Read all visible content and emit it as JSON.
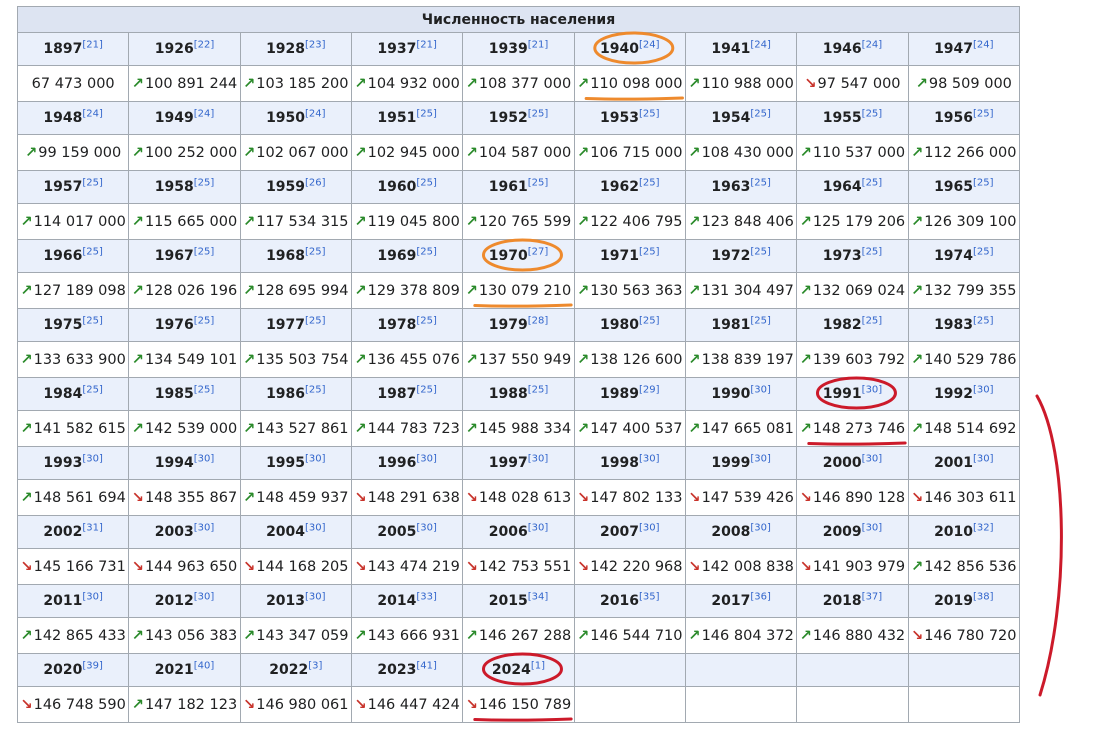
{
  "table": {
    "title": "Численность населения",
    "columns": 9,
    "rows": [
      [
        [
          "1897",
          "[21]",
          ""
        ],
        [
          "1926",
          "[22]",
          "up"
        ],
        [
          "1928",
          "[23]",
          "up"
        ],
        [
          "1937",
          "[21]",
          "up"
        ],
        [
          "1939",
          "[21]",
          "up"
        ],
        [
          "1940",
          "[24]",
          "up"
        ],
        [
          "1941",
          "[24]",
          "up"
        ],
        [
          "1946",
          "[24]",
          "down"
        ],
        [
          "1947",
          "[24]",
          "up"
        ]
      ],
      [
        [
          "1948",
          "[24]",
          "up"
        ],
        [
          "1949",
          "[24]",
          "up"
        ],
        [
          "1950",
          "[24]",
          "up"
        ],
        [
          "1951",
          "[25]",
          "up"
        ],
        [
          "1952",
          "[25]",
          "up"
        ],
        [
          "1953",
          "[25]",
          "up"
        ],
        [
          "1954",
          "[25]",
          "up"
        ],
        [
          "1955",
          "[25]",
          "up"
        ],
        [
          "1956",
          "[25]",
          "up"
        ]
      ],
      [
        [
          "1957",
          "[25]",
          "up"
        ],
        [
          "1958",
          "[25]",
          "up"
        ],
        [
          "1959",
          "[26]",
          "up"
        ],
        [
          "1960",
          "[25]",
          "up"
        ],
        [
          "1961",
          "[25]",
          "up"
        ],
        [
          "1962",
          "[25]",
          "up"
        ],
        [
          "1963",
          "[25]",
          "up"
        ],
        [
          "1964",
          "[25]",
          "up"
        ],
        [
          "1965",
          "[25]",
          "up"
        ]
      ],
      [
        [
          "1966",
          "[25]",
          "up"
        ],
        [
          "1967",
          "[25]",
          "up"
        ],
        [
          "1968",
          "[25]",
          "up"
        ],
        [
          "1969",
          "[25]",
          "up"
        ],
        [
          "1970",
          "[27]",
          "up"
        ],
        [
          "1971",
          "[25]",
          "up"
        ],
        [
          "1972",
          "[25]",
          "up"
        ],
        [
          "1973",
          "[25]",
          "up"
        ],
        [
          "1974",
          "[25]",
          "up"
        ]
      ],
      [
        [
          "1975",
          "[25]",
          "up"
        ],
        [
          "1976",
          "[25]",
          "up"
        ],
        [
          "1977",
          "[25]",
          "up"
        ],
        [
          "1978",
          "[25]",
          "up"
        ],
        [
          "1979",
          "[28]",
          "up"
        ],
        [
          "1980",
          "[25]",
          "up"
        ],
        [
          "1981",
          "[25]",
          "up"
        ],
        [
          "1982",
          "[25]",
          "up"
        ],
        [
          "1983",
          "[25]",
          "up"
        ]
      ],
      [
        [
          "1984",
          "[25]",
          "up"
        ],
        [
          "1985",
          "[25]",
          "up"
        ],
        [
          "1986",
          "[25]",
          "up"
        ],
        [
          "1987",
          "[25]",
          "up"
        ],
        [
          "1988",
          "[25]",
          "up"
        ],
        [
          "1989",
          "[29]",
          "up"
        ],
        [
          "1990",
          "[30]",
          "up"
        ],
        [
          "1991",
          "[30]",
          "up"
        ],
        [
          "1992",
          "[30]",
          "up"
        ]
      ],
      [
        [
          "1993",
          "[30]",
          "up"
        ],
        [
          "1994",
          "[30]",
          "down"
        ],
        [
          "1995",
          "[30]",
          "up"
        ],
        [
          "1996",
          "[30]",
          "down"
        ],
        [
          "1997",
          "[30]",
          "down"
        ],
        [
          "1998",
          "[30]",
          "down"
        ],
        [
          "1999",
          "[30]",
          "down"
        ],
        [
          "2000",
          "[30]",
          "down"
        ],
        [
          "2001",
          "[30]",
          "down"
        ]
      ],
      [
        [
          "2002",
          "[31]",
          "down"
        ],
        [
          "2003",
          "[30]",
          "down"
        ],
        [
          "2004",
          "[30]",
          "down"
        ],
        [
          "2005",
          "[30]",
          "down"
        ],
        [
          "2006",
          "[30]",
          "down"
        ],
        [
          "2007",
          "[30]",
          "down"
        ],
        [
          "2008",
          "[30]",
          "down"
        ],
        [
          "2009",
          "[30]",
          "down"
        ],
        [
          "2010",
          "[32]",
          "up"
        ]
      ],
      [
        [
          "2011",
          "[30]",
          "up"
        ],
        [
          "2012",
          "[30]",
          "up"
        ],
        [
          "2013",
          "[30]",
          "up"
        ],
        [
          "2014",
          "[33]",
          "up"
        ],
        [
          "2015",
          "[34]",
          "up"
        ],
        [
          "2016",
          "[35]",
          "up"
        ],
        [
          "2017",
          "[36]",
          "up"
        ],
        [
          "2018",
          "[37]",
          "up"
        ],
        [
          "2019",
          "[38]",
          "down"
        ]
      ],
      [
        [
          "2020",
          "[39]",
          "down"
        ],
        [
          "2021",
          "[40]",
          "up"
        ],
        [
          "2022",
          "[3]",
          "down"
        ],
        [
          "2023",
          "[41]",
          "down"
        ],
        [
          "2024",
          "[1]",
          "down"
        ],
        [
          "",
          "",
          ""
        ],
        [
          "",
          "",
          ""
        ],
        [
          "",
          "",
          ""
        ],
        [
          "",
          "",
          ""
        ]
      ]
    ],
    "values": [
      [
        "67 473 000",
        "100 891 244",
        "103 185 200",
        "104 932 000",
        "108 377 000",
        "110 098 000",
        "110 988 000",
        "97 547 000",
        "98 509 000"
      ],
      [
        "99 159 000",
        "100 252 000",
        "102 067 000",
        "102 945 000",
        "104 587 000",
        "106 715 000",
        "108 430 000",
        "110 537 000",
        "112 266 000"
      ],
      [
        "114 017 000",
        "115 665 000",
        "117 534 315",
        "119 045 800",
        "120 765 599",
        "122 406 795",
        "123 848 406",
        "125 179 206",
        "126 309 100"
      ],
      [
        "127 189 098",
        "128 026 196",
        "128 695 994",
        "129 378 809",
        "130 079 210",
        "130 563 363",
        "131 304 497",
        "132 069 024",
        "132 799 355"
      ],
      [
        "133 633 900",
        "134 549 101",
        "135 503 754",
        "136 455 076",
        "137 550 949",
        "138 126 600",
        "138 839 197",
        "139 603 792",
        "140 529 786"
      ],
      [
        "141 582 615",
        "142 539 000",
        "143 527 861",
        "144 783 723",
        "145 988 334",
        "147 400 537",
        "147 665 081",
        "148 273 746",
        "148 514 692"
      ],
      [
        "148 561 694",
        "148 355 867",
        "148 459 937",
        "148 291 638",
        "148 028 613",
        "147 802 133",
        "147 539 426",
        "146 890 128",
        "146 303 611"
      ],
      [
        "145 166 731",
        "144 963 650",
        "144 168 205",
        "143 474 219",
        "142 753 551",
        "142 220 968",
        "142 008 838",
        "141 903 979",
        "142 856 536"
      ],
      [
        "142 865 433",
        "143 056 383",
        "143 347 059",
        "143 666 931",
        "146 267 288",
        "146 544 710",
        "146 804 372",
        "146 880 432",
        "146 780 720"
      ],
      [
        "146 748 590",
        "147 182 123",
        "146 980 061",
        "146 447 424",
        "146 150 789",
        "",
        "",
        "",
        ""
      ]
    ],
    "arrow_up": "↗",
    "arrow_down": "↘",
    "colors": {
      "up": "#2a8a2a",
      "down": "#c8332b",
      "link": "#3366cc",
      "header_bg": "#eaf0fb",
      "title_bg": "#dde4f2",
      "border": "#a2a9b1"
    }
  },
  "annotations": {
    "orange_color": "#ee8a2d",
    "red_color": "#cc1a2a",
    "circled_years": [
      {
        "row": 0,
        "col": 5,
        "color": "orange"
      },
      {
        "row": 3,
        "col": 4,
        "color": "orange"
      },
      {
        "row": 5,
        "col": 7,
        "color": "red"
      },
      {
        "row": 9,
        "col": 4,
        "color": "red"
      }
    ],
    "right_bracket": "red"
  }
}
